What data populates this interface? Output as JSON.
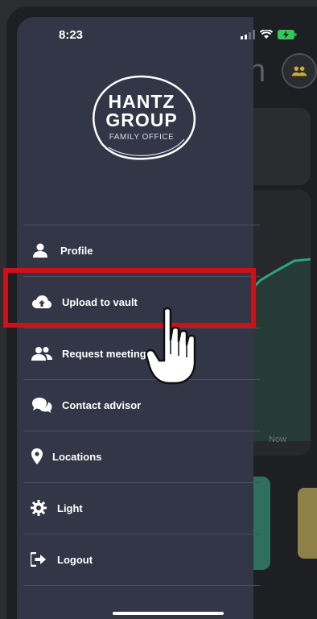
{
  "status_bar": {
    "time": "8:23"
  },
  "logo": {
    "line1": "HANTZ",
    "line2": "GROUP",
    "line3": "FAMILY OFFICE"
  },
  "background": {
    "title_fragment": "n",
    "chart_label": "Now"
  },
  "menu": {
    "items": [
      {
        "label": "Profile",
        "icon": "user-icon"
      },
      {
        "label": "Upload to vault",
        "icon": "cloud-upload-icon"
      },
      {
        "label": "Request meeting",
        "icon": "users-icon"
      },
      {
        "label": "Contact advisor",
        "icon": "chat-bubbles-icon"
      },
      {
        "label": "Locations",
        "icon": "map-pin-icon"
      },
      {
        "label": "Light",
        "icon": "gear-sun-icon"
      },
      {
        "label": "Logout",
        "icon": "logout-icon"
      }
    ]
  },
  "colors": {
    "drawer_bg": "#333647",
    "highlight": "#c8131a",
    "accent_green": "#2f6f5d",
    "accent_yellow": "#8e8148"
  }
}
